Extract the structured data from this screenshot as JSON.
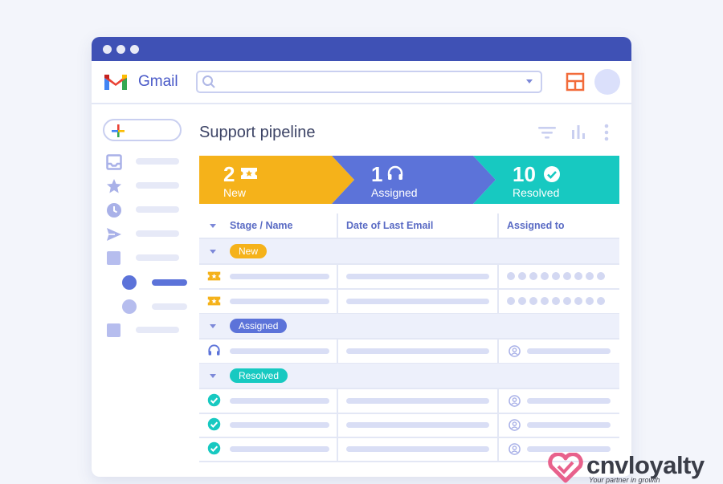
{
  "app": {
    "name": "Gmail"
  },
  "search": {
    "placeholder": ""
  },
  "page": {
    "title": "Support pipeline"
  },
  "pipeline": [
    {
      "count": "2",
      "label": "New",
      "color": "#f5b21a",
      "icon": "ticket-icon"
    },
    {
      "count": "1",
      "label": "Assigned",
      "color": "#5c73d9",
      "icon": "headset-icon"
    },
    {
      "count": "10",
      "label": "Resolved",
      "color": "#17c9c1",
      "icon": "check-circle-icon"
    }
  ],
  "table": {
    "columns": [
      "Stage / Name",
      "Date of Last Email",
      "Assigned to"
    ],
    "groups": [
      {
        "label": "New",
        "color": "#f5b21a",
        "rows": 2
      },
      {
        "label": "Assigned",
        "color": "#5c73d9",
        "rows": 1
      },
      {
        "label": "Resolved",
        "color": "#17c9c1",
        "rows": 3
      }
    ]
  },
  "branding": {
    "name": "cnvloyalty",
    "tagline": "Your partner in growth"
  }
}
